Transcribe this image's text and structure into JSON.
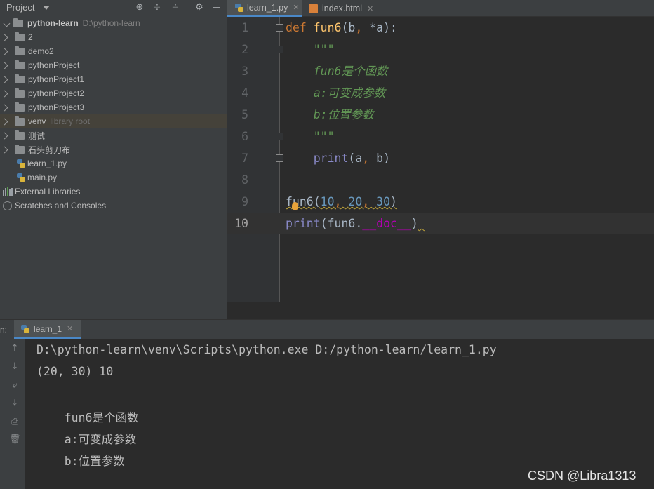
{
  "project_panel": {
    "title": "Project",
    "root_name": "python-learn",
    "root_path": "D:\\python-learn",
    "items": [
      {
        "label": "2",
        "kind": "folder"
      },
      {
        "label": "demo2",
        "kind": "folder"
      },
      {
        "label": "pythonProject",
        "kind": "folder"
      },
      {
        "label": "pythonProject1",
        "kind": "folder"
      },
      {
        "label": "pythonProject2",
        "kind": "folder"
      },
      {
        "label": "pythonProject3",
        "kind": "folder"
      },
      {
        "label": "venv",
        "kind": "folder",
        "hint": "library root"
      },
      {
        "label": "测试",
        "kind": "folder"
      },
      {
        "label": "石头剪刀布",
        "kind": "folder"
      },
      {
        "label": "learn_1.py",
        "kind": "python-file"
      },
      {
        "label": "main.py",
        "kind": "python-file"
      }
    ],
    "external_libraries": "External Libraries",
    "scratches": "Scratches and Consoles"
  },
  "editor": {
    "tabs": [
      {
        "label": "learn_1.py",
        "active": true
      },
      {
        "label": "index.html",
        "active": false
      }
    ],
    "line_numbers": [
      "1",
      "2",
      "3",
      "4",
      "5",
      "6",
      "7",
      "8",
      "9",
      "10"
    ],
    "current_line": 10
  },
  "run": {
    "panel_label": "n:",
    "tab_label": "learn_1",
    "output": [
      "D:\\python-learn\\venv\\Scripts\\python.exe D:/python-learn/learn_1.py",
      "(20, 30) 10",
      "",
      "    fun6是个函数",
      "    a:可变成参数",
      "    b:位置参数"
    ]
  },
  "watermark": "CSDN @Libra1313",
  "colors": {
    "keyword": "#cc7832",
    "function": "#ffc66d",
    "docstring": "#629755",
    "builtin": "#8888c6",
    "number": "#6897bb",
    "dunder": "#b200b2",
    "accent": "#4a88c7"
  }
}
